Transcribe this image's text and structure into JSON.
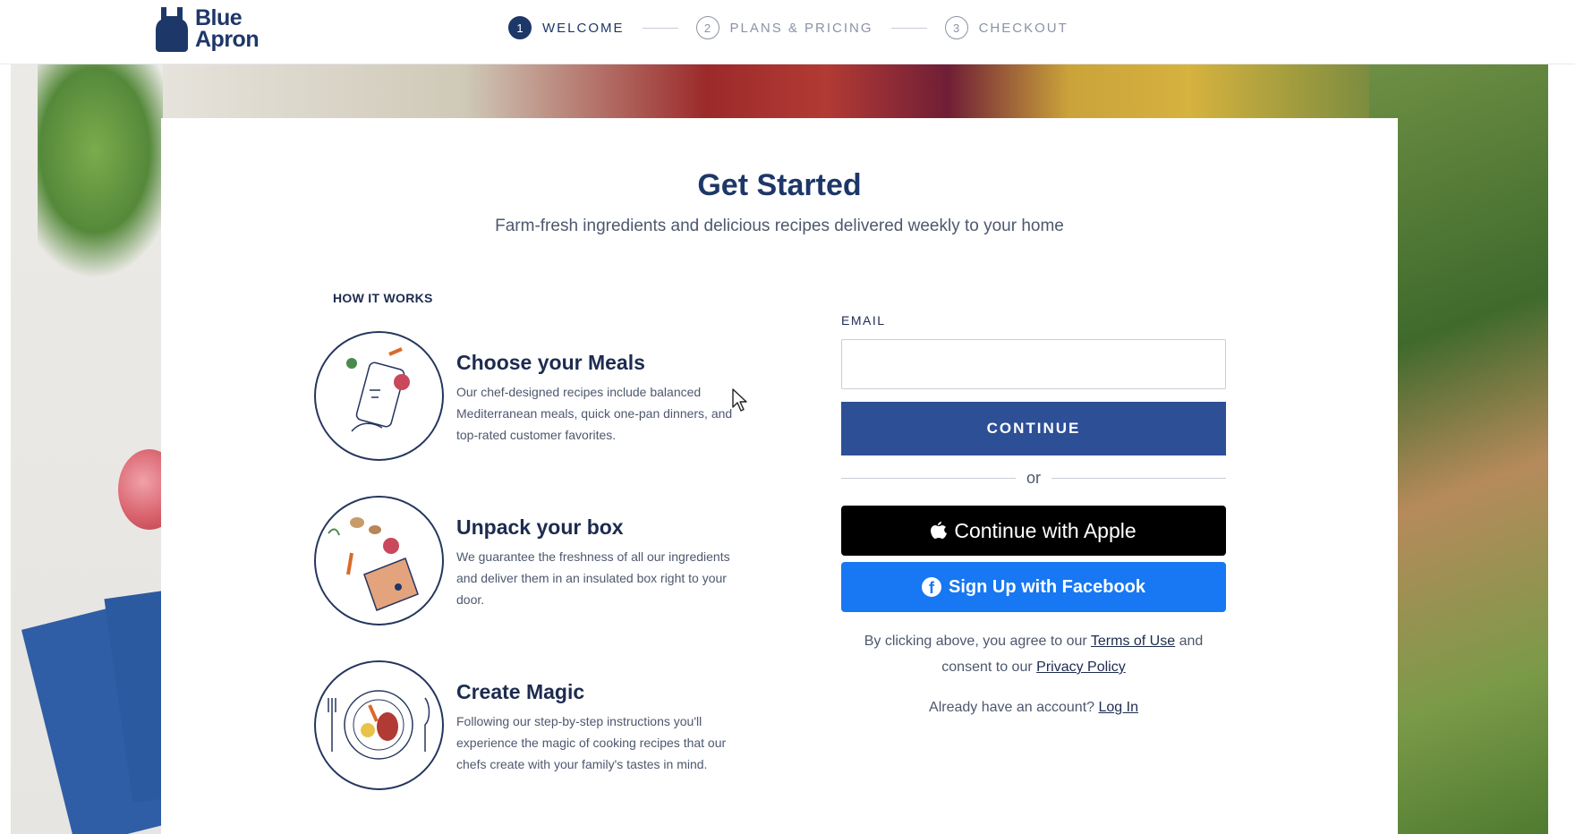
{
  "header": {
    "logo_line1": "Blue",
    "logo_line2": "Apron",
    "steps": [
      {
        "number": "1",
        "label": "WELCOME",
        "active": true
      },
      {
        "number": "2",
        "label": "PLANS & PRICING",
        "active": false
      },
      {
        "number": "3",
        "label": "CHECKOUT",
        "active": false
      }
    ]
  },
  "main": {
    "title": "Get Started",
    "subtitle": "Farm-fresh ingredients and delicious recipes delivered weekly to your home"
  },
  "how_it_works": {
    "heading": "HOW IT WORKS",
    "items": [
      {
        "title": "Choose your Meals",
        "text": "Our chef-designed recipes include balanced Mediterranean meals, quick one-pan dinners, and top-rated customer favorites."
      },
      {
        "title": "Unpack your box",
        "text": "We guarantee the freshness of all our ingredients and deliver them in an insulated box right to your door."
      },
      {
        "title": "Create Magic",
        "text": "Following our step-by-step instructions you'll experience the magic of cooking recipes that our chefs create with your family's tastes in mind."
      }
    ]
  },
  "signup": {
    "email_label": "EMAIL",
    "email_value": "",
    "continue_label": "CONTINUE",
    "or_text": "or",
    "apple_label": "Continue with Apple",
    "facebook_label": "Sign Up with Facebook",
    "legal_prefix": "By clicking above, you agree to our",
    "terms_link": "Terms of Use",
    "legal_mid": "and consent to our",
    "privacy_link": "Privacy Policy",
    "login_prefix": "Already have an account?",
    "login_link": "Log In"
  },
  "colors": {
    "brand_navy": "#1e3769",
    "continue_blue": "#2d4f96",
    "facebook_blue": "#1877f2",
    "apple_black": "#000000"
  },
  "icons": [
    "blue-apron-logo-icon",
    "apple-icon",
    "facebook-icon",
    "mouse-cursor-icon"
  ]
}
